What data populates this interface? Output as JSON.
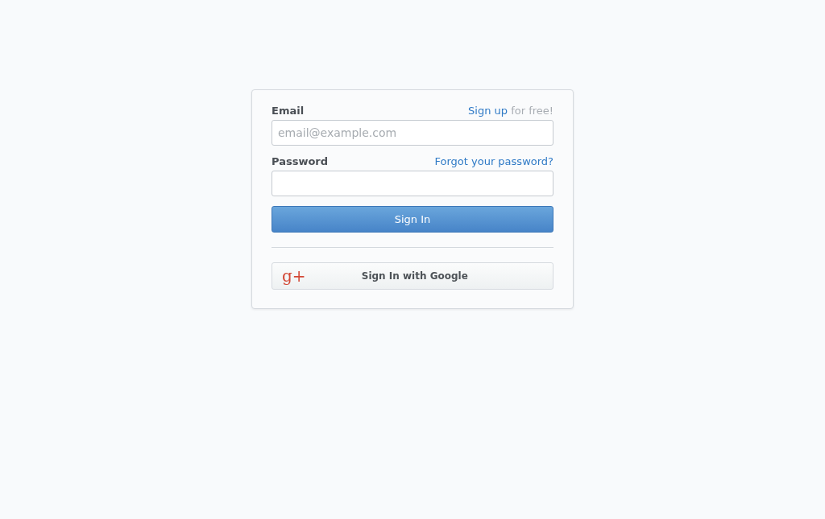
{
  "email": {
    "label": "Email",
    "signup_link": "Sign up",
    "signup_suffix": "for free!",
    "placeholder": "email@example.com"
  },
  "password": {
    "label": "Password",
    "forgot_link": "Forgot your password?"
  },
  "sign_in_button": "Sign In",
  "google_button": {
    "icon_text": "g+",
    "label": "Sign In with Google"
  }
}
